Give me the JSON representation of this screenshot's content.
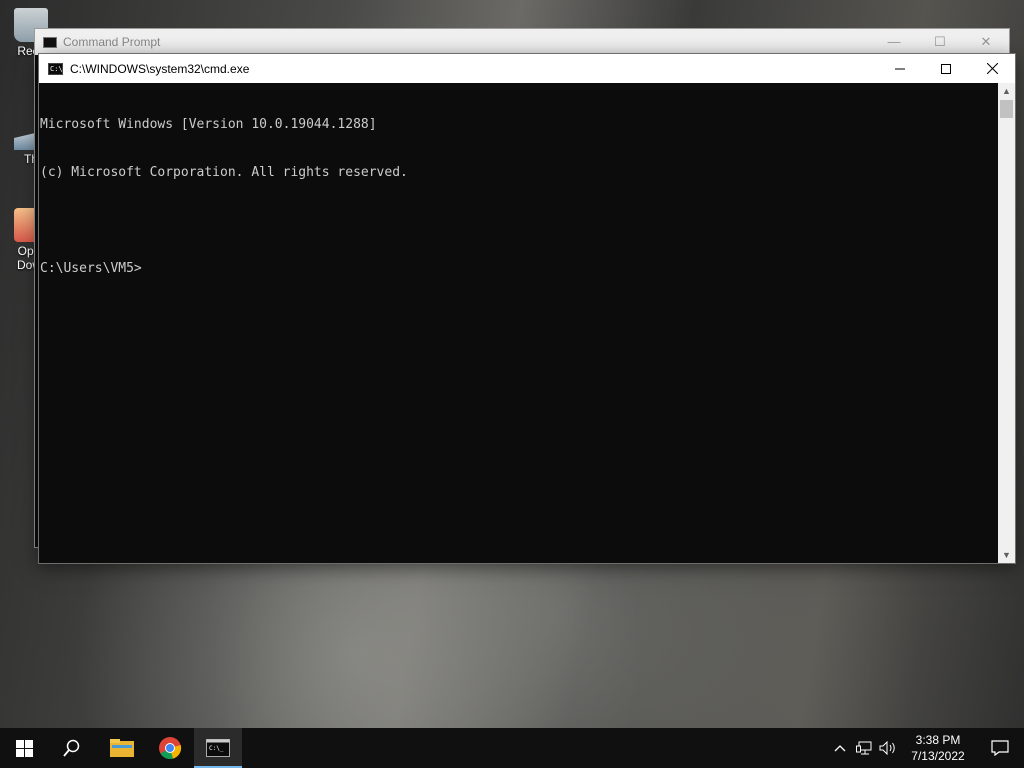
{
  "desktop": {
    "icons": [
      {
        "label": "Recy"
      },
      {
        "label": "Th"
      },
      {
        "label": "Oper\nDowr"
      }
    ]
  },
  "background_window": {
    "title": "Command Prompt"
  },
  "cmd_window": {
    "title": "C:\\WINDOWS\\system32\\cmd.exe",
    "lines": [
      "Microsoft Windows [Version 10.0.19044.1288]",
      "(c) Microsoft Corporation. All rights reserved.",
      "",
      "C:\\Users\\VM5>"
    ]
  },
  "taskbar": {
    "clock_time": "3:38 PM",
    "clock_date": "7/13/2022",
    "pinned": [
      "start-icon",
      "search-icon",
      "file-explorer-icon",
      "chrome-icon",
      "command-prompt-icon"
    ],
    "tray_icons": [
      "chevron-up-icon",
      "network-icon",
      "volume-icon",
      "notification-icon"
    ]
  },
  "colors": {
    "console_bg": "#0c0c0c",
    "console_fg": "#cccccc",
    "taskbar_bg": "#101010",
    "active_accent": "#76b9ed"
  }
}
